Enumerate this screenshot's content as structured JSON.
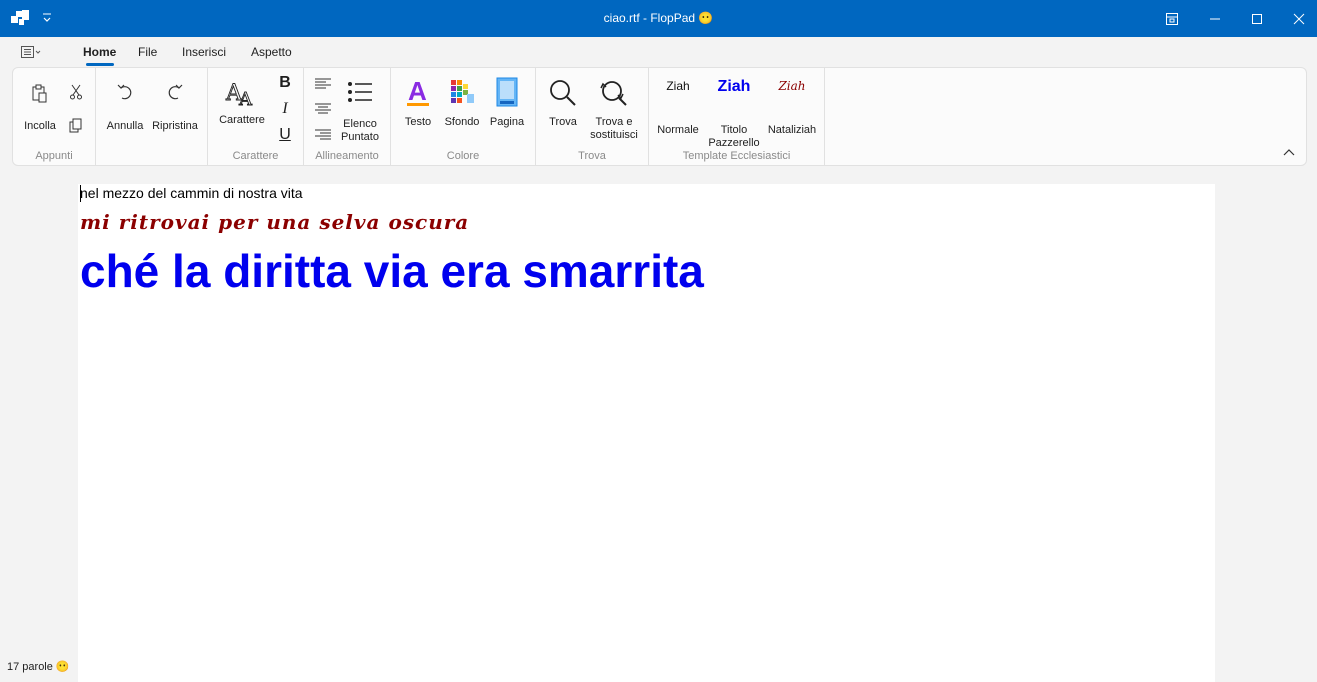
{
  "window": {
    "title": "ciao.rtf - FlopPad 😶"
  },
  "tabs": [
    {
      "label": "Home",
      "active": true
    },
    {
      "label": "File",
      "active": false
    },
    {
      "label": "Inserisci",
      "active": false
    },
    {
      "label": "Aspetto",
      "active": false
    }
  ],
  "ribbon": {
    "appunti": {
      "group_label": "Appunti",
      "incolla": "Incolla"
    },
    "history": {
      "annulla": "Annulla",
      "ripristina": "Ripristina"
    },
    "carattere": {
      "group_label": "Carattere",
      "carattere": "Carattere",
      "bold": "B",
      "italic": "I",
      "underline": "U"
    },
    "allineamento": {
      "group_label": "Allineamento",
      "elenco_line1": "Elenco",
      "elenco_line2": "Puntato"
    },
    "colore": {
      "group_label": "Colore",
      "testo": "Testo",
      "sfondo": "Sfondo",
      "pagina": "Pagina"
    },
    "trova": {
      "group_label": "Trova",
      "trova": "Trova",
      "sostituisci_line1": "Trova e",
      "sostituisci_line2": "sostituisci"
    },
    "template": {
      "group_label": "Template Ecclesiastici",
      "normale_preview": "Ziah",
      "normale": "Normale",
      "titolo_preview": "Ziah",
      "titolo_line1": "Titolo",
      "titolo_line2": "Pazzerello",
      "natale_preview": "Ziah",
      "natale": "Nataliziah"
    }
  },
  "document": {
    "line1": "nel mezzo del cammin di nostra vita",
    "line2": "mi ritrovai per una selva oscura",
    "line3": "ché la diritta via era smarrita"
  },
  "status": {
    "word_count": "17 parole 😶"
  },
  "colors": {
    "accent": "#0067c0",
    "line2_color": "#8b0000",
    "line3_color": "#0000ee"
  }
}
